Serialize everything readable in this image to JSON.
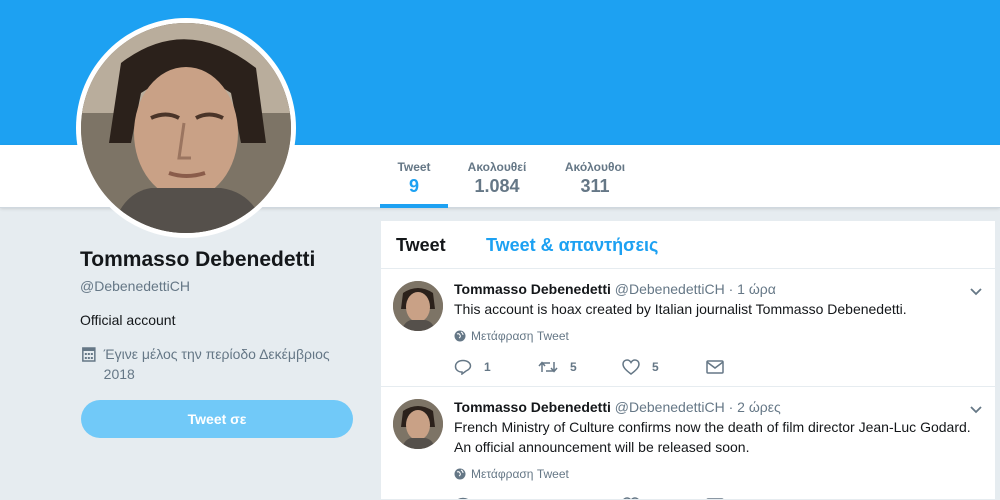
{
  "colors": {
    "accent": "#1da1f2",
    "banner": "#1da1f2",
    "page_bg": "#e6ecf0",
    "secondary_text": "#657786",
    "button_disabled": "#71c9f8"
  },
  "stats": [
    {
      "label": "Tweet",
      "value": "9"
    },
    {
      "label": "Ακολουθεί",
      "value": "1.084"
    },
    {
      "label": "Ακόλουθοι",
      "value": "311"
    }
  ],
  "profile": {
    "name": "Tommasso Debenedetti",
    "handle": "@DebenedettiCH",
    "bio": "Official account",
    "joined": "Έγινε μέλος την περίοδο Δεκέμβριος 2018",
    "tweet_to_button": "Tweet σε"
  },
  "timeline": {
    "tabs": [
      "Tweet",
      "Tweet & απαντήσεις"
    ],
    "tweets": [
      {
        "name": "Tommasso Debenedetti",
        "handle": "@DebenedettiCH",
        "time": "· 1 ώρα",
        "text": "This account is hoax created by Italian journalist Tommasso Debenedetti.",
        "translate": "Μετάφραση Tweet",
        "replies": "1",
        "retweets": "5",
        "likes": "5"
      },
      {
        "name": "Tommasso Debenedetti",
        "handle": "@DebenedettiCH",
        "time": "· 2 ώρες",
        "text": "French Ministry of Culture confirms now the death of film director Jean-Luc Godard. An official announcement will be released soon.",
        "translate": "Μετάφραση Tweet"
      }
    ]
  },
  "icons": [
    "calendar-icon",
    "globe-icon",
    "reply-icon",
    "retweet-icon",
    "like-icon",
    "message-icon",
    "chevron-down-icon"
  ]
}
